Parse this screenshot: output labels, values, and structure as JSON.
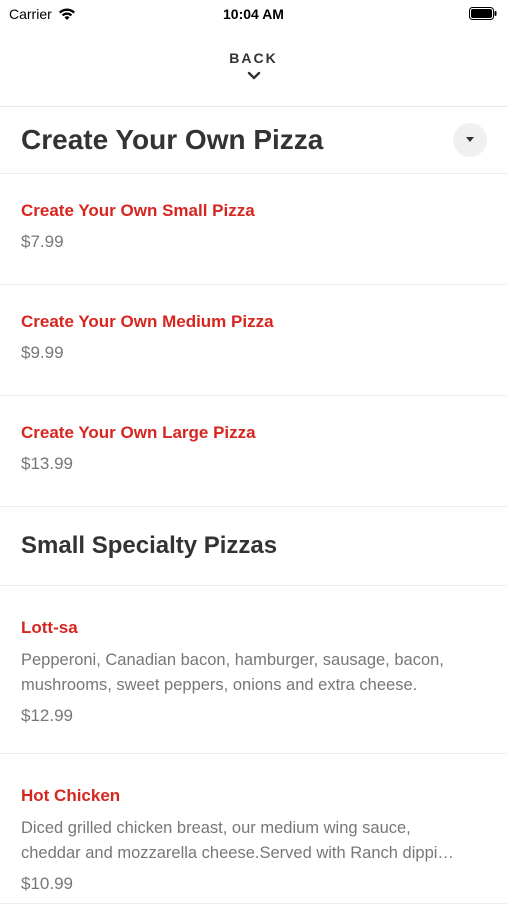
{
  "status_bar": {
    "carrier": "Carrier",
    "time": "10:04 AM"
  },
  "nav": {
    "back_label": "BACK"
  },
  "category": {
    "title": "Create Your Own Pizza"
  },
  "create_items": [
    {
      "name": "Create Your Own Small Pizza",
      "price": "$7.99"
    },
    {
      "name": "Create Your Own Medium Pizza",
      "price": "$9.99"
    },
    {
      "name": "Create Your Own Large Pizza",
      "price": "$13.99"
    }
  ],
  "specialty_section": {
    "title": "Small Specialty Pizzas",
    "items": [
      {
        "name": "Lott-sa",
        "desc_line1": "Pepperoni, Canadian bacon, hamburger, sausage, bacon,",
        "desc_line2": "mushrooms, sweet peppers, onions and extra cheese.",
        "price": "$12.99"
      },
      {
        "name": "Hot Chicken",
        "desc_line1": "Diced grilled chicken breast, our medium wing sauce,",
        "desc_line2": "cheddar and mozzarella cheese.Served with Ranch dippi…",
        "price": "$10.99"
      }
    ]
  },
  "colors": {
    "accent": "#d6261f",
    "text": "#333333",
    "muted": "#777777",
    "divider": "#eeeeee"
  }
}
